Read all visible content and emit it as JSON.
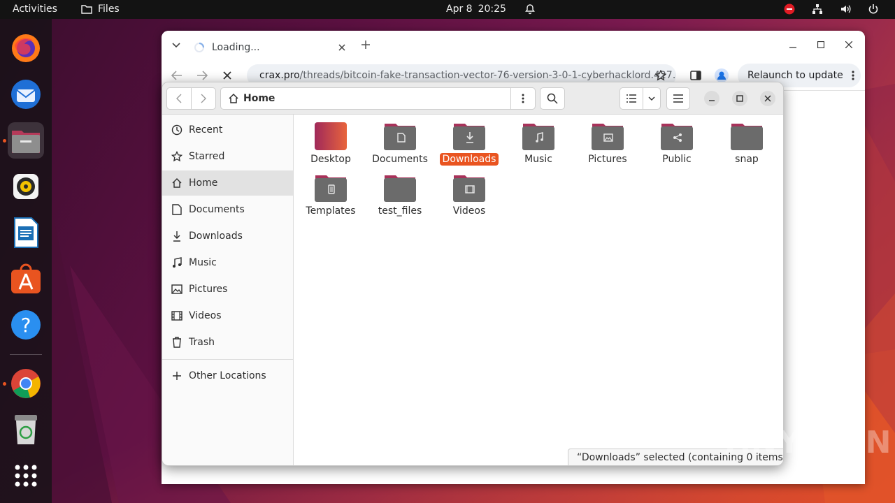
{
  "topbar": {
    "activities": "Activities",
    "app_name": "Files",
    "date": "Apr 8",
    "time": "20:25"
  },
  "dock": {
    "items": [
      "firefox",
      "thunderbird",
      "files",
      "rhythmbox",
      "libreoffice-writer",
      "app-center",
      "help",
      "chrome",
      "trash",
      "show-apps"
    ]
  },
  "browser": {
    "tab_title": "Loading...",
    "url_domain": "crax.pro",
    "url_path": "/threads/bitcoin-fake-transaction-vector-76-version-3-0-1-cyberhacklord.427…",
    "relaunch_label": "Relaunch to update"
  },
  "files": {
    "location": "Home",
    "sidebar": [
      {
        "label": "Recent",
        "icon": "clock-icon"
      },
      {
        "label": "Starred",
        "icon": "star-icon"
      },
      {
        "label": "Home",
        "icon": "home-icon",
        "selected": true
      },
      {
        "label": "Documents",
        "icon": "document-icon"
      },
      {
        "label": "Downloads",
        "icon": "download-icon"
      },
      {
        "label": "Music",
        "icon": "music-icon"
      },
      {
        "label": "Pictures",
        "icon": "picture-icon"
      },
      {
        "label": "Videos",
        "icon": "video-icon"
      },
      {
        "label": "Trash",
        "icon": "trash-icon"
      }
    ],
    "other_locations": "Other Locations",
    "folders": [
      {
        "label": "Desktop",
        "emblem": "none",
        "color": "#c4376a"
      },
      {
        "label": "Documents",
        "emblem": "document",
        "color": "#6a6a6a"
      },
      {
        "label": "Downloads",
        "emblem": "download",
        "color": "#6a6a6a",
        "selected": true
      },
      {
        "label": "Music",
        "emblem": "music",
        "color": "#6a6a6a"
      },
      {
        "label": "Pictures",
        "emblem": "picture",
        "color": "#6a6a6a"
      },
      {
        "label": "Public",
        "emblem": "share",
        "color": "#6a6a6a"
      },
      {
        "label": "snap",
        "emblem": "none",
        "color": "#6a6a6a"
      },
      {
        "label": "Templates",
        "emblem": "template",
        "color": "#6a6a6a"
      },
      {
        "label": "test_files",
        "emblem": "none",
        "color": "#6a6a6a"
      },
      {
        "label": "Videos",
        "emblem": "video",
        "color": "#6a6a6a"
      }
    ],
    "status": "“Downloads” selected  (containing 0 items)"
  },
  "watermark": "ANY RUN",
  "colors": {
    "accent": "#e95420",
    "folder_tab": "#a8325a",
    "folder_body": "#6b6b6b"
  }
}
